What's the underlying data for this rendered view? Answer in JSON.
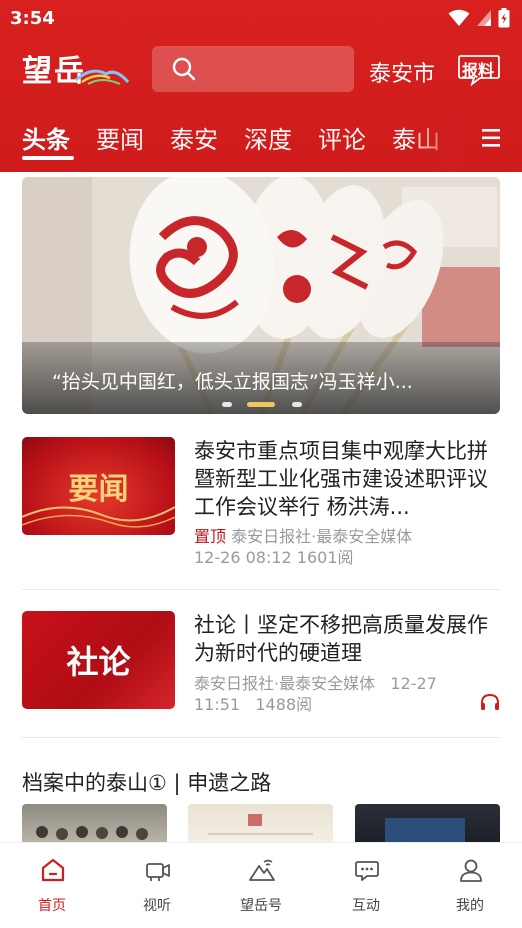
{
  "status_bar": {
    "time": "3:54"
  },
  "header": {
    "logo_text": "望岳",
    "search": {
      "placeholder": ""
    },
    "city": "泰安市",
    "report_label": "报料"
  },
  "tabs": [
    {
      "label": "头条",
      "active": true
    },
    {
      "label": "要闻",
      "active": false
    },
    {
      "label": "泰安",
      "active": false
    },
    {
      "label": "深度",
      "active": false
    },
    {
      "label": "评论",
      "active": false
    },
    {
      "label": "泰山",
      "active": false
    }
  ],
  "banner": {
    "caption": "“抬头见中国红，低头立报国志”冯玉祥小...",
    "slide_count": 3,
    "active_slide": 2
  },
  "news": [
    {
      "thumb_label": "要闻",
      "title": "泰安市重点项目集中观摩大比拼暨新型工业化强市建设述职评议工作会议举行 杨洪涛...",
      "pin": "置顶",
      "source": "泰安日报社·最泰安全媒体",
      "time": "12-26 08:12",
      "reads": "1601阅"
    },
    {
      "thumb_label": "社论",
      "title": "社论丨坚定不移把高质量发展作为新时代的硬道理",
      "source": "泰安日报社·最泰安全媒体",
      "time_part1": "12-27",
      "time_part2": "11:51",
      "reads": "1488阅"
    }
  ],
  "section": {
    "title": "档案中的泰山① | 申遗之路"
  },
  "bottom_nav": [
    {
      "label": "首页",
      "icon": "home-icon",
      "active": true
    },
    {
      "label": "视听",
      "icon": "video-icon",
      "active": false
    },
    {
      "label": "望岳号",
      "icon": "mountain-icon",
      "active": false
    },
    {
      "label": "互动",
      "icon": "chat-icon",
      "active": false
    },
    {
      "label": "我的",
      "icon": "person-icon",
      "active": false
    }
  ],
  "colors": {
    "brand_red": "#d01e1e",
    "meta_gray": "#9a9a9a",
    "text": "#222222"
  }
}
